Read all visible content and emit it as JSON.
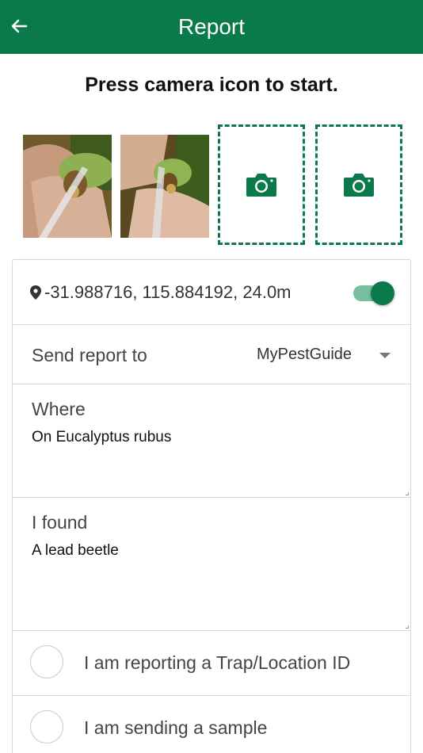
{
  "appbar": {
    "title": "Report",
    "back_icon": "arrow-left-icon",
    "color": "#0a7a4a"
  },
  "prompt": "Press camera icon to start.",
  "photos": [
    {
      "name": "photo-1",
      "description_icon": "photo-thumbnail"
    },
    {
      "name": "photo-2",
      "description_icon": "photo-thumbnail"
    }
  ],
  "camera_slots": [
    {
      "icon": "camera-icon"
    },
    {
      "icon": "camera-icon"
    }
  ],
  "location": {
    "icon": "map-pin-icon",
    "text": "-31.988716, 115.884192, 24.0m",
    "toggle_on": true
  },
  "send_report": {
    "label": "Send report to",
    "value": "MyPestGuide"
  },
  "where": {
    "label": "Where",
    "value": "On Eucalyptus rubus"
  },
  "found": {
    "label": "I found",
    "value": "A lead beetle"
  },
  "options": {
    "trap": "I am reporting a Trap/Location ID",
    "sample": "I am sending a sample"
  }
}
